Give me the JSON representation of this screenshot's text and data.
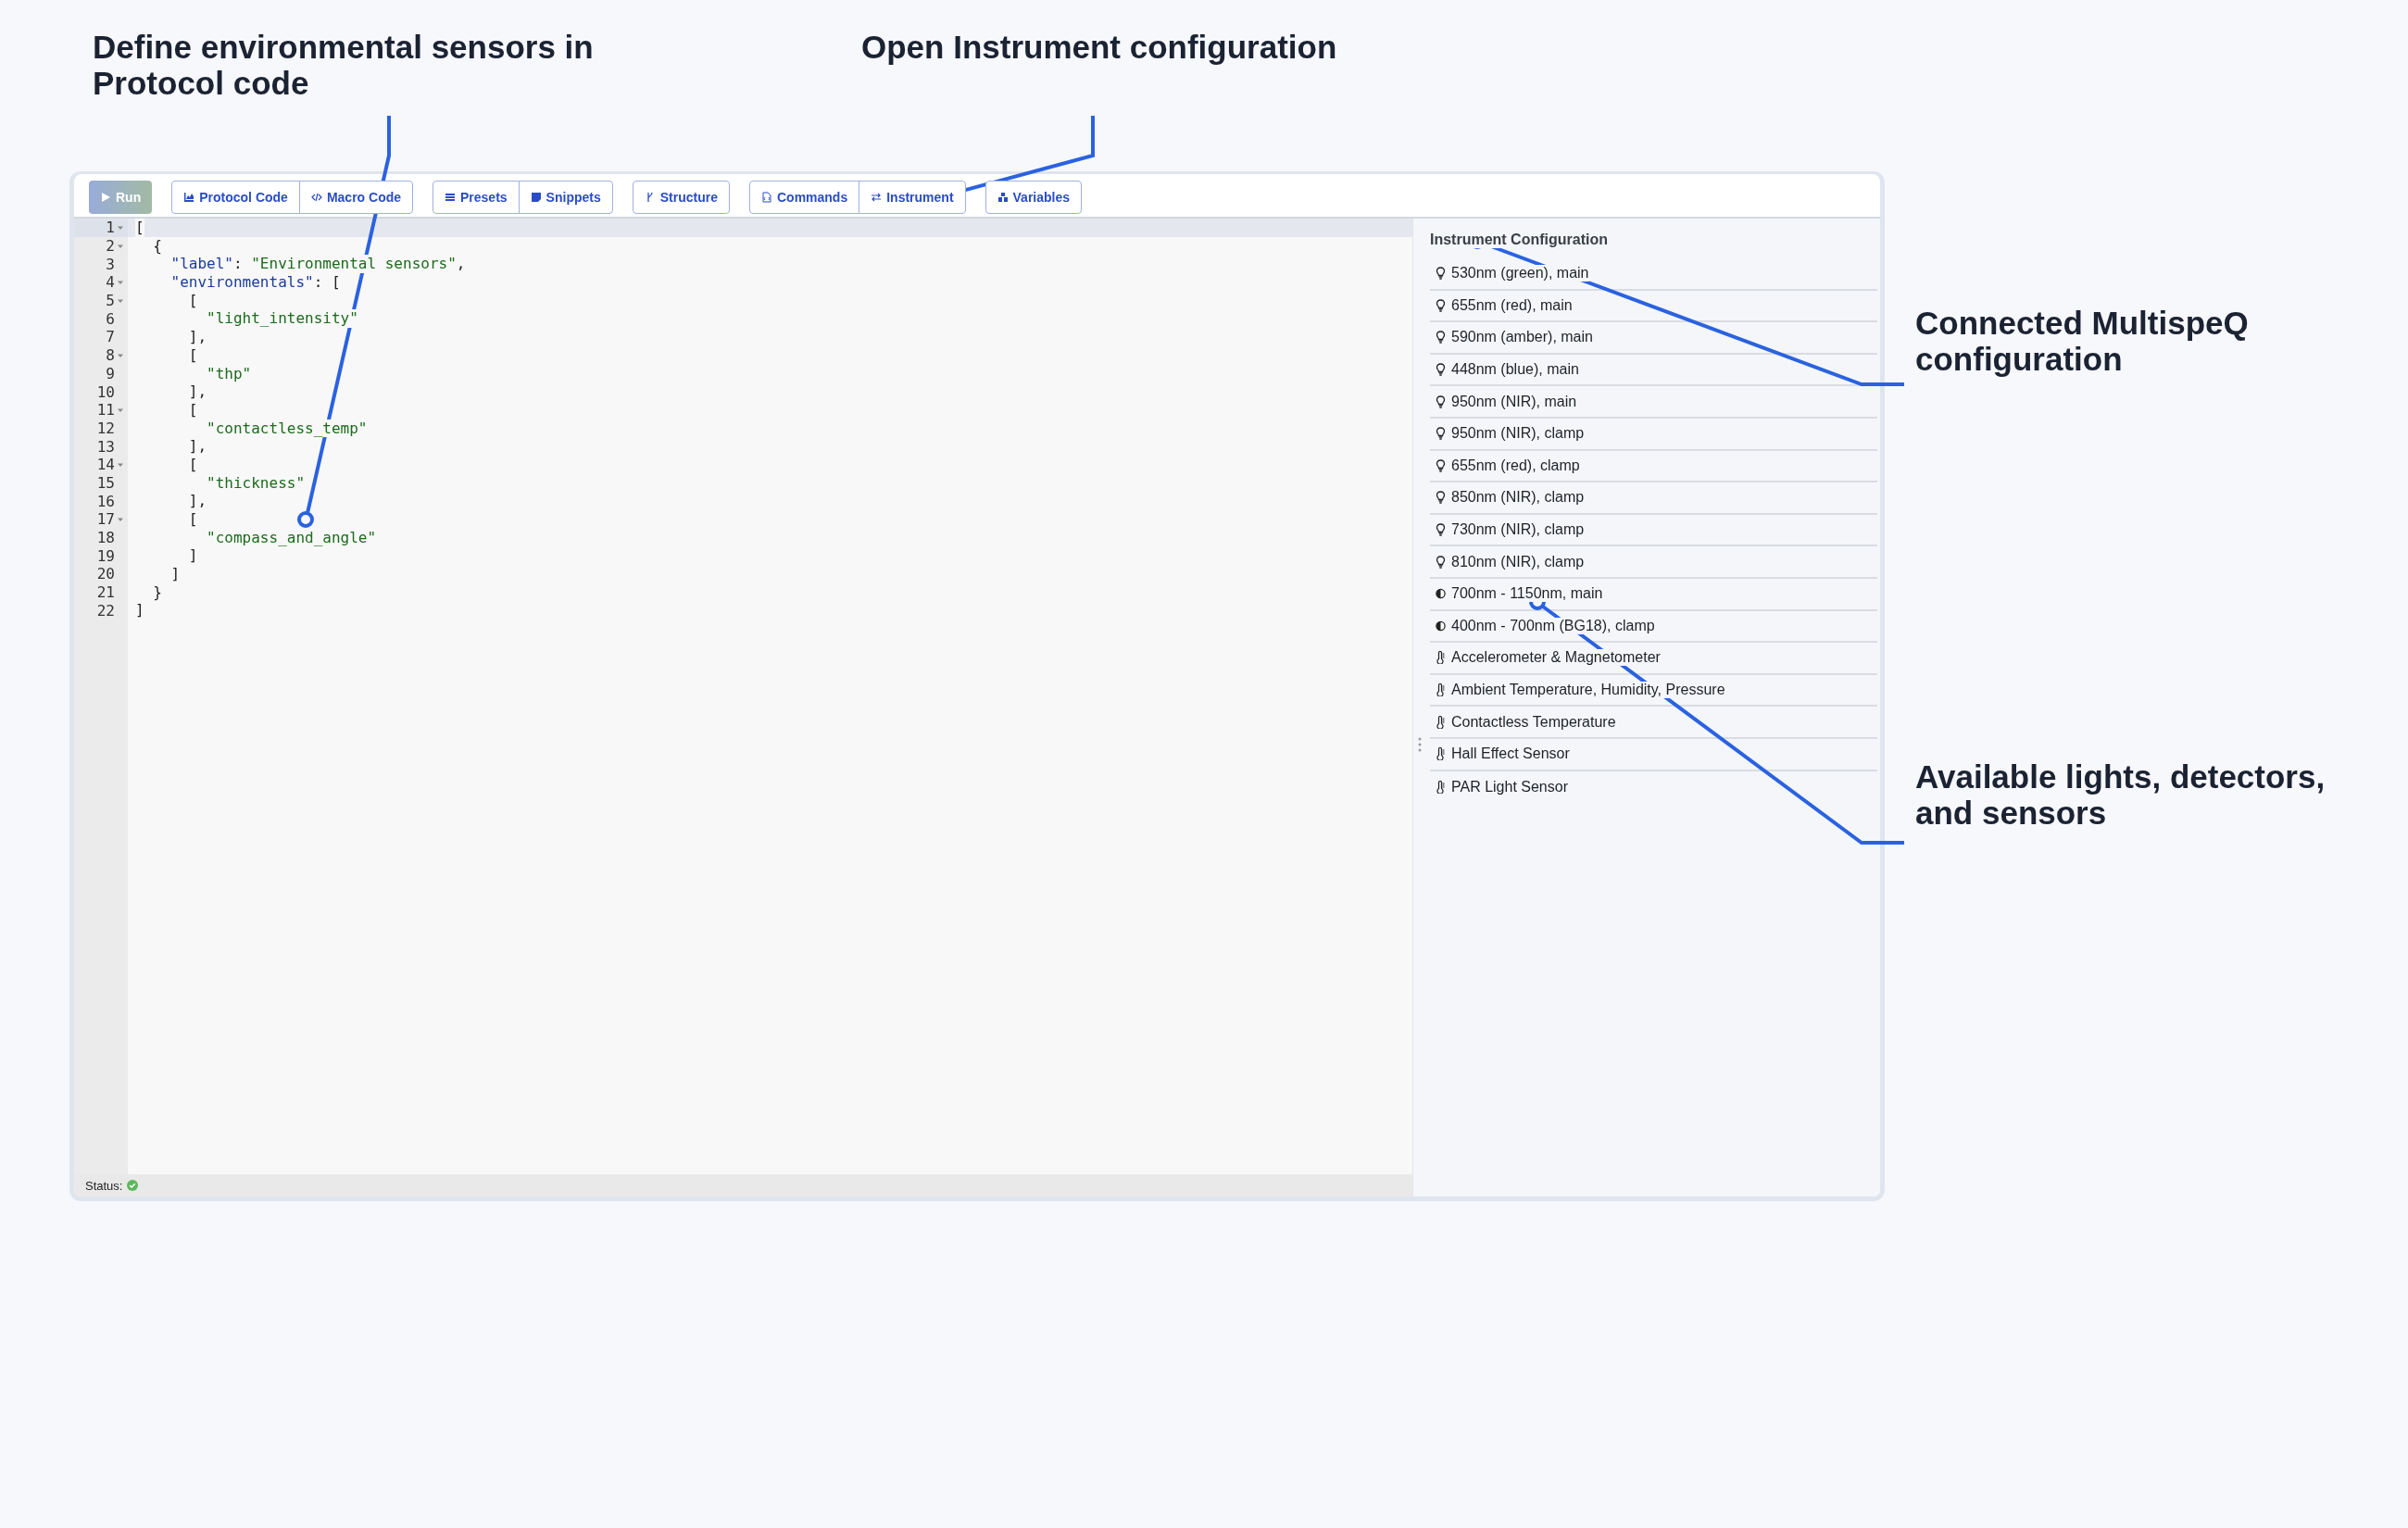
{
  "annotations": [
    {
      "text": "Define environmental sensors in Protocol code"
    },
    {
      "text": "Open Instrument configuration"
    },
    {
      "text": "Connected MultispeQ configuration"
    },
    {
      "text": "Available lights, detectors, and sensors"
    }
  ],
  "toolbar": {
    "groups": [
      [
        {
          "label": "Run",
          "disabled": true
        }
      ],
      [
        {
          "label": "Protocol Code",
          "disabled": false
        },
        {
          "label": "Macro Code",
          "disabled": false
        }
      ],
      [
        {
          "label": "Presets",
          "disabled": false
        },
        {
          "label": "Snippets",
          "disabled": false
        }
      ],
      [
        {
          "label": "Structure",
          "disabled": false
        }
      ],
      [
        {
          "label": "Commands",
          "disabled": false
        },
        {
          "label": "Instrument",
          "disabled": false
        }
      ],
      [
        {
          "label": "Variables",
          "disabled": false
        }
      ]
    ]
  },
  "editor": {
    "lines": [
      {
        "number": "1",
        "foldable": true,
        "active": true,
        "text": "["
      },
      {
        "number": "2",
        "foldable": true,
        "active": false,
        "text": "  {"
      },
      {
        "number": "3",
        "foldable": false,
        "active": false,
        "text": "    \"label\": \"Environmental sensors\","
      },
      {
        "number": "4",
        "foldable": true,
        "active": false,
        "text": "    \"environmentals\": ["
      },
      {
        "number": "5",
        "foldable": true,
        "active": false,
        "text": "      ["
      },
      {
        "number": "6",
        "foldable": false,
        "active": false,
        "text": "        \"light_intensity\""
      },
      {
        "number": "7",
        "foldable": false,
        "active": false,
        "text": "      ],"
      },
      {
        "number": "8",
        "foldable": true,
        "active": false,
        "text": "      ["
      },
      {
        "number": "9",
        "foldable": false,
        "active": false,
        "text": "        \"thp\""
      },
      {
        "number": "10",
        "foldable": false,
        "active": false,
        "text": "      ],"
      },
      {
        "number": "11",
        "foldable": true,
        "active": false,
        "text": "      ["
      },
      {
        "number": "12",
        "foldable": false,
        "active": false,
        "text": "        \"contactless_temp\""
      },
      {
        "number": "13",
        "foldable": false,
        "active": false,
        "text": "      ],"
      },
      {
        "number": "14",
        "foldable": true,
        "active": false,
        "text": "      ["
      },
      {
        "number": "15",
        "foldable": false,
        "active": false,
        "text": "        \"thickness\""
      },
      {
        "number": "16",
        "foldable": false,
        "active": false,
        "text": "      ],"
      },
      {
        "number": "17",
        "foldable": true,
        "active": false,
        "text": "      ["
      },
      {
        "number": "18",
        "foldable": false,
        "active": false,
        "text": "        \"compass_and_angle\""
      },
      {
        "number": "19",
        "foldable": false,
        "active": false,
        "text": "      ]"
      },
      {
        "number": "20",
        "foldable": false,
        "active": false,
        "text": "    ]"
      },
      {
        "number": "21",
        "foldable": false,
        "active": false,
        "text": "  }"
      },
      {
        "number": "22",
        "foldable": false,
        "active": false,
        "text": "]"
      }
    ]
  },
  "status_bar": {
    "label": "Status:",
    "ok": true
  },
  "panel": {
    "title": "Instrument Configuration",
    "items": [
      {
        "kind": "light",
        "label": "530nm (green), main"
      },
      {
        "kind": "light",
        "label": "655nm (red), main"
      },
      {
        "kind": "light",
        "label": "590nm (amber), main"
      },
      {
        "kind": "light",
        "label": "448nm (blue), main"
      },
      {
        "kind": "light",
        "label": "950nm (NIR), main"
      },
      {
        "kind": "light",
        "label": "950nm (NIR), clamp"
      },
      {
        "kind": "light",
        "label": "655nm (red), clamp"
      },
      {
        "kind": "light",
        "label": "850nm (NIR), clamp"
      },
      {
        "kind": "light",
        "label": "730nm (NIR), clamp"
      },
      {
        "kind": "light",
        "label": "810nm (NIR), clamp"
      },
      {
        "kind": "detector",
        "label": "700nm - 1150nm, main"
      },
      {
        "kind": "detector",
        "label": "400nm - 700nm (BG18), clamp"
      },
      {
        "kind": "sensor",
        "label": "Accelerometer & Magnetometer"
      },
      {
        "kind": "sensor",
        "label": "Ambient Temperature, Humidity, Pressure"
      },
      {
        "kind": "sensor",
        "label": "Contactless Temperature"
      },
      {
        "kind": "sensor",
        "label": "Hall Effect Sensor"
      },
      {
        "kind": "sensor",
        "label": "PAR Light Sensor"
      }
    ]
  }
}
